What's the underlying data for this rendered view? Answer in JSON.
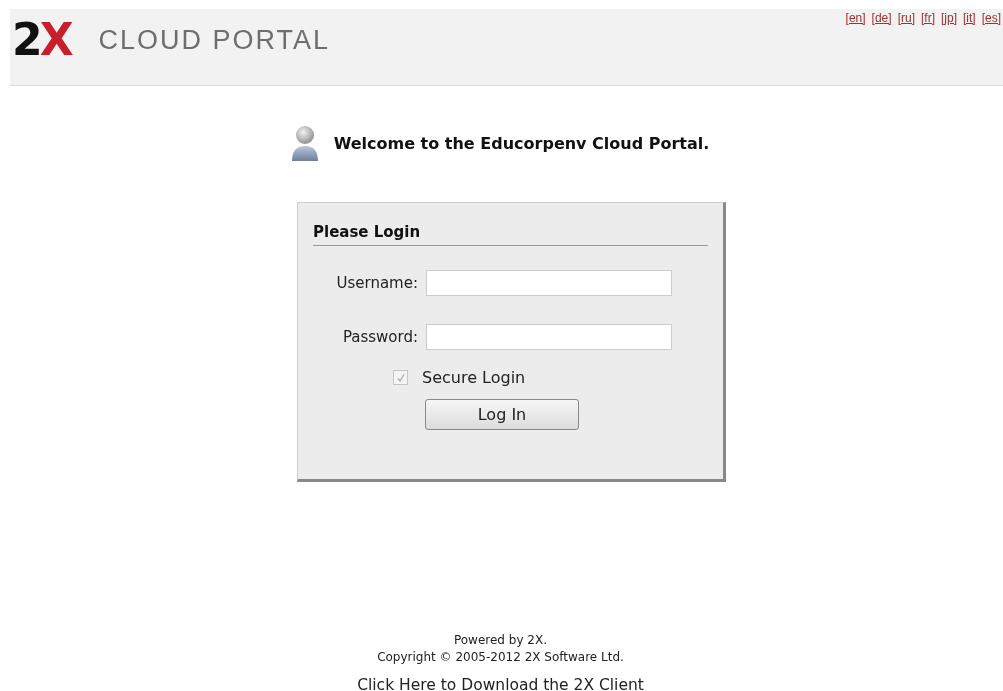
{
  "header": {
    "logo": {
      "mark_digit": "2",
      "mark_letter": "X",
      "title": "CLOUD PORTAL"
    },
    "languages": [
      {
        "label": "[en]"
      },
      {
        "label": "[de]"
      },
      {
        "label": "[ru]"
      },
      {
        "label": "[fr]"
      },
      {
        "label": "[jp]"
      },
      {
        "label": "[it]"
      },
      {
        "label": "[es]"
      }
    ]
  },
  "welcome": "Welcome to the Educorpenv Cloud Portal.",
  "login": {
    "title": "Please Login",
    "fields": [
      {
        "label": "Username:"
      },
      {
        "label": "Password:"
      }
    ],
    "secure_login": {
      "label": "Secure Login",
      "checked": true,
      "disabled": true
    },
    "button": "Log In"
  },
  "footer": {
    "powered": "Powered by 2X.",
    "copyright": "Copyright © 2005-2012 2X Software Ltd.",
    "download_link": "Click Here to Download the 2X Client"
  }
}
